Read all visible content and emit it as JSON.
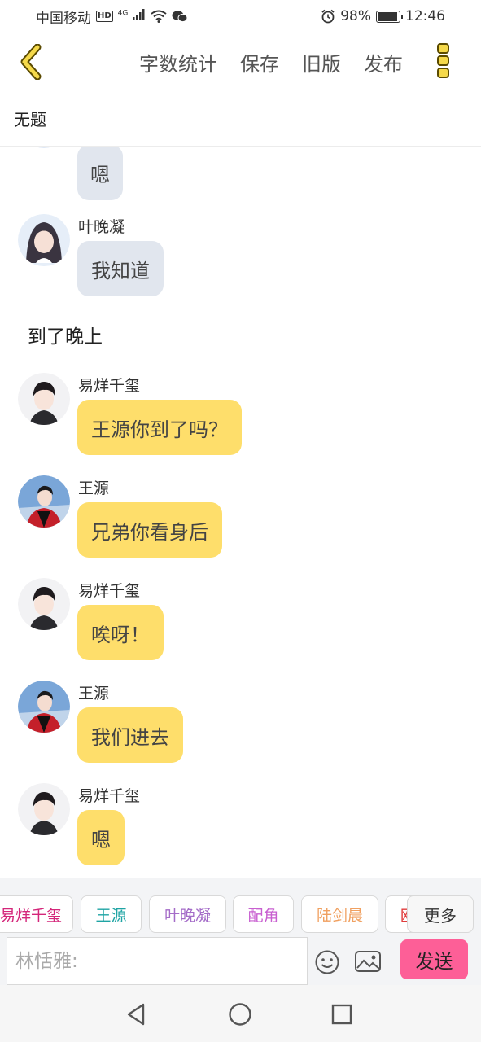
{
  "status_bar": {
    "carrier": "中国移动",
    "hd": "HD",
    "network": "4G",
    "battery": "98%",
    "time": "12:46"
  },
  "toolbar": {
    "word_count": "字数统计",
    "save": "保存",
    "old_version": "旧版",
    "publish": "发布"
  },
  "story": {
    "title": "无题"
  },
  "messages": [
    {
      "type": "bubble",
      "name": "",
      "text": "嗯",
      "style": "gray",
      "avatar": "girl"
    },
    {
      "type": "bubble",
      "name": "叶晚凝",
      "text": "我知道",
      "style": "gray",
      "avatar": "girl"
    },
    {
      "type": "narration",
      "text": "到了晚上"
    },
    {
      "type": "bubble",
      "name": "易烊千玺",
      "text": "王源你到了吗？",
      "style": "yellow",
      "avatar": "boy1"
    },
    {
      "type": "bubble",
      "name": "王源",
      "text": "兄弟你看身后",
      "style": "yellow",
      "avatar": "boy2"
    },
    {
      "type": "bubble",
      "name": "易烊千玺",
      "text": "唉呀！",
      "style": "yellow",
      "avatar": "boy1"
    },
    {
      "type": "bubble",
      "name": "王源",
      "text": "我们进去",
      "style": "yellow",
      "avatar": "boy2"
    },
    {
      "type": "bubble",
      "name": "易烊千玺",
      "text": "嗯",
      "style": "yellow",
      "avatar": "boy1"
    }
  ],
  "characters": [
    {
      "name": "易烊千玺",
      "color": "#d4267a"
    },
    {
      "name": "王源",
      "color": "#1fa4a4"
    },
    {
      "name": "叶晚凝",
      "color": "#a46cc8"
    },
    {
      "name": "配角",
      "color": "#c85fd0"
    },
    {
      "name": "陆剑晨",
      "color": "#f0a060"
    },
    {
      "name": "欧",
      "color": "#e03c3c"
    }
  ],
  "more_chip": "更多",
  "input": {
    "placeholder": "林恬雅:"
  },
  "send_label": "发送",
  "colors": {
    "send": "#fd5f97",
    "bubble_yellow": "#fede6b",
    "bubble_gray": "#e1e6ee",
    "accent": "#f5d94a"
  }
}
